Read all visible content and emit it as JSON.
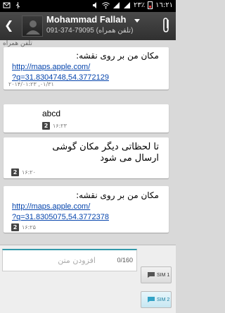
{
  "status_bar": {
    "time": "١٦:٢١",
    "battery": "٢٣٪"
  },
  "header": {
    "contact_name": "Mohammad Fallah",
    "contact_number": "091-374-79095 (تلفن همراه)"
  },
  "conversation": {
    "top_tag": "تلفن همراه",
    "messages": [
      {
        "text": "مکان من بر روی نقشه:",
        "link": "http://maps.apple.com/?q=31.8304748,54.3772129",
        "link_line1": "http://maps.apple.com/",
        "link_line2": "?q=31.8304748,54.3772129",
        "time": "٢٠١۴/٠١/٣١, ٠١:٢٣"
      },
      {
        "text": "abcd",
        "sim": "2",
        "time": "١۶:٢٣"
      },
      {
        "text_line1": "تا لحظاتی دیگر مکان گوشی",
        "text_line2": "ارسال می شود",
        "sim": "2",
        "time": "١۶:٢٠"
      },
      {
        "text": "مکان من بر روی نقشه:",
        "link": "http://maps.apple.com/?q=31.8305075,54.3772378",
        "link_line1": "http://maps.apple.com/",
        "link_line2": "?q=31.8305075,54.3772378",
        "sim": "2",
        "time": "١۶:٢۵"
      }
    ]
  },
  "compose": {
    "placeholder": "افزودن متن",
    "char_count": "0/160",
    "sim1_label": "SIM 1",
    "sim2_label": "SIM 2"
  },
  "colors": {
    "link": "#0645ad",
    "accent": "#33a3c6"
  }
}
